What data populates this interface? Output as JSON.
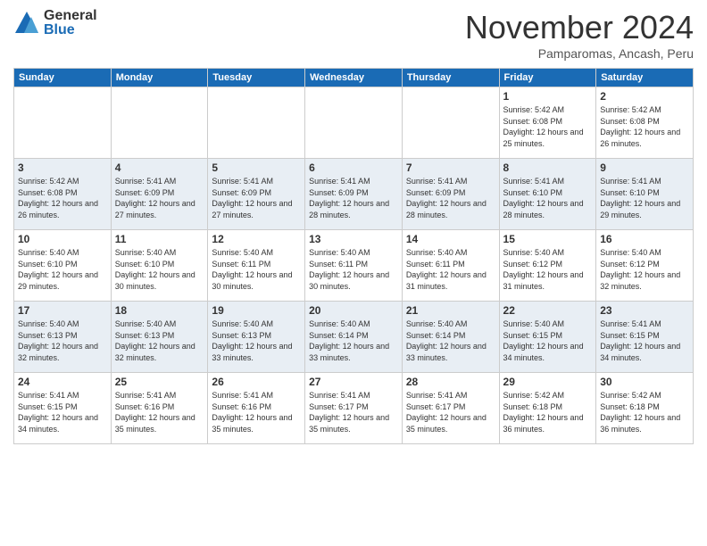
{
  "logo": {
    "general": "General",
    "blue": "Blue"
  },
  "title": "November 2024",
  "subtitle": "Pamparomas, Ancash, Peru",
  "days_header": [
    "Sunday",
    "Monday",
    "Tuesday",
    "Wednesday",
    "Thursday",
    "Friday",
    "Saturday"
  ],
  "weeks": [
    [
      {
        "day": "",
        "info": ""
      },
      {
        "day": "",
        "info": ""
      },
      {
        "day": "",
        "info": ""
      },
      {
        "day": "",
        "info": ""
      },
      {
        "day": "",
        "info": ""
      },
      {
        "day": "1",
        "info": "Sunrise: 5:42 AM\nSunset: 6:08 PM\nDaylight: 12 hours and 25 minutes."
      },
      {
        "day": "2",
        "info": "Sunrise: 5:42 AM\nSunset: 6:08 PM\nDaylight: 12 hours and 26 minutes."
      }
    ],
    [
      {
        "day": "3",
        "info": "Sunrise: 5:42 AM\nSunset: 6:08 PM\nDaylight: 12 hours and 26 minutes."
      },
      {
        "day": "4",
        "info": "Sunrise: 5:41 AM\nSunset: 6:09 PM\nDaylight: 12 hours and 27 minutes."
      },
      {
        "day": "5",
        "info": "Sunrise: 5:41 AM\nSunset: 6:09 PM\nDaylight: 12 hours and 27 minutes."
      },
      {
        "day": "6",
        "info": "Sunrise: 5:41 AM\nSunset: 6:09 PM\nDaylight: 12 hours and 28 minutes."
      },
      {
        "day": "7",
        "info": "Sunrise: 5:41 AM\nSunset: 6:09 PM\nDaylight: 12 hours and 28 minutes."
      },
      {
        "day": "8",
        "info": "Sunrise: 5:41 AM\nSunset: 6:10 PM\nDaylight: 12 hours and 28 minutes."
      },
      {
        "day": "9",
        "info": "Sunrise: 5:41 AM\nSunset: 6:10 PM\nDaylight: 12 hours and 29 minutes."
      }
    ],
    [
      {
        "day": "10",
        "info": "Sunrise: 5:40 AM\nSunset: 6:10 PM\nDaylight: 12 hours and 29 minutes."
      },
      {
        "day": "11",
        "info": "Sunrise: 5:40 AM\nSunset: 6:10 PM\nDaylight: 12 hours and 30 minutes."
      },
      {
        "day": "12",
        "info": "Sunrise: 5:40 AM\nSunset: 6:11 PM\nDaylight: 12 hours and 30 minutes."
      },
      {
        "day": "13",
        "info": "Sunrise: 5:40 AM\nSunset: 6:11 PM\nDaylight: 12 hours and 30 minutes."
      },
      {
        "day": "14",
        "info": "Sunrise: 5:40 AM\nSunset: 6:11 PM\nDaylight: 12 hours and 31 minutes."
      },
      {
        "day": "15",
        "info": "Sunrise: 5:40 AM\nSunset: 6:12 PM\nDaylight: 12 hours and 31 minutes."
      },
      {
        "day": "16",
        "info": "Sunrise: 5:40 AM\nSunset: 6:12 PM\nDaylight: 12 hours and 32 minutes."
      }
    ],
    [
      {
        "day": "17",
        "info": "Sunrise: 5:40 AM\nSunset: 6:13 PM\nDaylight: 12 hours and 32 minutes."
      },
      {
        "day": "18",
        "info": "Sunrise: 5:40 AM\nSunset: 6:13 PM\nDaylight: 12 hours and 32 minutes."
      },
      {
        "day": "19",
        "info": "Sunrise: 5:40 AM\nSunset: 6:13 PM\nDaylight: 12 hours and 33 minutes."
      },
      {
        "day": "20",
        "info": "Sunrise: 5:40 AM\nSunset: 6:14 PM\nDaylight: 12 hours and 33 minutes."
      },
      {
        "day": "21",
        "info": "Sunrise: 5:40 AM\nSunset: 6:14 PM\nDaylight: 12 hours and 33 minutes."
      },
      {
        "day": "22",
        "info": "Sunrise: 5:40 AM\nSunset: 6:15 PM\nDaylight: 12 hours and 34 minutes."
      },
      {
        "day": "23",
        "info": "Sunrise: 5:41 AM\nSunset: 6:15 PM\nDaylight: 12 hours and 34 minutes."
      }
    ],
    [
      {
        "day": "24",
        "info": "Sunrise: 5:41 AM\nSunset: 6:15 PM\nDaylight: 12 hours and 34 minutes."
      },
      {
        "day": "25",
        "info": "Sunrise: 5:41 AM\nSunset: 6:16 PM\nDaylight: 12 hours and 35 minutes."
      },
      {
        "day": "26",
        "info": "Sunrise: 5:41 AM\nSunset: 6:16 PM\nDaylight: 12 hours and 35 minutes."
      },
      {
        "day": "27",
        "info": "Sunrise: 5:41 AM\nSunset: 6:17 PM\nDaylight: 12 hours and 35 minutes."
      },
      {
        "day": "28",
        "info": "Sunrise: 5:41 AM\nSunset: 6:17 PM\nDaylight: 12 hours and 35 minutes."
      },
      {
        "day": "29",
        "info": "Sunrise: 5:42 AM\nSunset: 6:18 PM\nDaylight: 12 hours and 36 minutes."
      },
      {
        "day": "30",
        "info": "Sunrise: 5:42 AM\nSunset: 6:18 PM\nDaylight: 12 hours and 36 minutes."
      }
    ]
  ]
}
